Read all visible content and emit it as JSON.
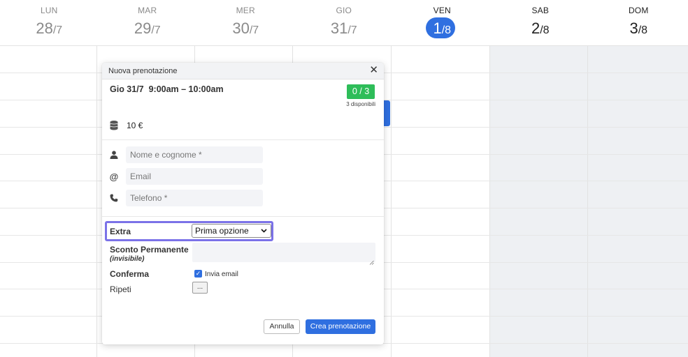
{
  "calendar": {
    "days": [
      {
        "name": "LUN",
        "num": "28",
        "month": "/7"
      },
      {
        "name": "MAR",
        "num": "29",
        "month": "/7"
      },
      {
        "name": "MER",
        "num": "30",
        "month": "/7"
      },
      {
        "name": "GIO",
        "num": "31",
        "month": "/7"
      },
      {
        "name": "VEN",
        "num": "1",
        "month": "/8"
      },
      {
        "name": "SAB",
        "num": "2",
        "month": "/8"
      },
      {
        "name": "DOM",
        "num": "3",
        "month": "/8"
      }
    ]
  },
  "modal": {
    "title": "Nuova prenotazione",
    "close_glyph": "✕",
    "slot": "Gio 31/7  9:00am – 10:00am",
    "badge": "0 / 3",
    "available_text": "3 disponibili",
    "price": "10 €",
    "fields": {
      "name_placeholder": "Nome e cognome *",
      "email_placeholder": "Email",
      "phone_placeholder": "Telefono *"
    },
    "extra_label": "Extra",
    "extra_selected": "Prima opzione",
    "sconto_label": "Sconto Permanente",
    "sconto_sub": "(invisibile)",
    "conferma_label": "Conferma",
    "invia_email_label": "Invia email",
    "invia_email_checked": true,
    "ripeti_label": "Ripeti",
    "ripeti_button": "...",
    "cancel_label": "Annulla",
    "create_label": "Crea prenotazione"
  },
  "colors": {
    "accent": "#2f6fe0",
    "badge_green": "#2ebd59",
    "highlight": "#7b72e8"
  }
}
